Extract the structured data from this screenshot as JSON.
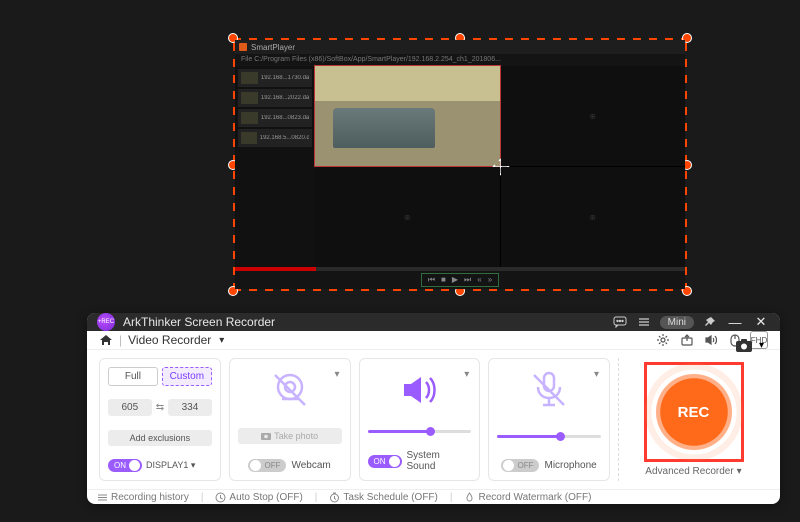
{
  "player": {
    "title": "SmartPlayer",
    "path": "File  C:/Program Files (x86)/SoftBox/App/SmartPlayer/192.168.2.254_ch1_201806...",
    "playlist": [
      {
        "name": "192.168...1730.dav"
      },
      {
        "name": "192.168...2022.dav"
      },
      {
        "name": "192.168...0823.dav"
      },
      {
        "name": "192.168.5...0820.dav"
      }
    ],
    "quad_placeholder": "⊕"
  },
  "recorder": {
    "title": "ArkThinker Screen Recorder",
    "mini": "Mini",
    "sub_title": "Video Recorder",
    "fhd": "FHD",
    "size": {
      "full": "Full",
      "custom": "Custom",
      "w": "605",
      "h": "334",
      "exclusions": "Add exclusions",
      "on": "ON",
      "display": "DISPLAY1"
    },
    "webcam": {
      "off": "OFF",
      "label": "Webcam",
      "take_photo": "Take photo"
    },
    "sound": {
      "on": "ON",
      "label": "System Sound"
    },
    "mic": {
      "off": "OFF",
      "label": "Microphone"
    },
    "rec": "REC",
    "advanced": "Advanced Recorder",
    "footer": {
      "history": "Recording history",
      "autostop": "Auto Stop (OFF)",
      "schedule": "Task Schedule (OFF)",
      "watermark": "Record Watermark (OFF)"
    }
  }
}
